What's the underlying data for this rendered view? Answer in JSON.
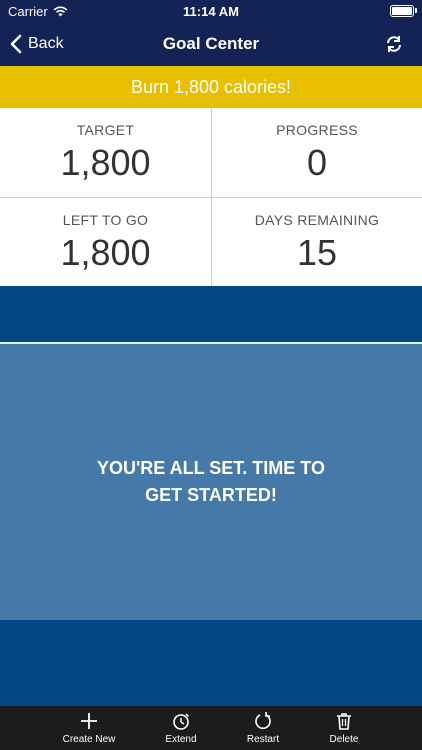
{
  "status_bar": {
    "carrier": "Carrier",
    "time": "11:14 AM"
  },
  "nav": {
    "back_label": "Back",
    "title": "Goal Center"
  },
  "goal": {
    "banner": "Burn 1,800 calories!"
  },
  "stats": {
    "target": {
      "label": "TARGET",
      "value": "1,800"
    },
    "progress": {
      "label": "PROGRESS",
      "value": "0"
    },
    "left_to_go": {
      "label": "LEFT TO GO",
      "value": "1,800"
    },
    "days_remaining": {
      "label": "DAYS REMAINING",
      "value": "15"
    }
  },
  "message": {
    "text": "YOU'RE ALL SET. TIME TO GET STARTED!"
  },
  "tabs": [
    {
      "label": "Create New",
      "icon": "plus-icon"
    },
    {
      "label": "Extend",
      "icon": "stopwatch-icon"
    },
    {
      "label": "Restart",
      "icon": "restart-icon"
    },
    {
      "label": "Delete",
      "icon": "trash-icon"
    }
  ],
  "colors": {
    "nav_bg": "#142356",
    "banner_bg": "#e8c000",
    "band_bg": "#034884",
    "message_bg": "#4579a8",
    "tab_bar_bg": "#1c1c1c"
  }
}
